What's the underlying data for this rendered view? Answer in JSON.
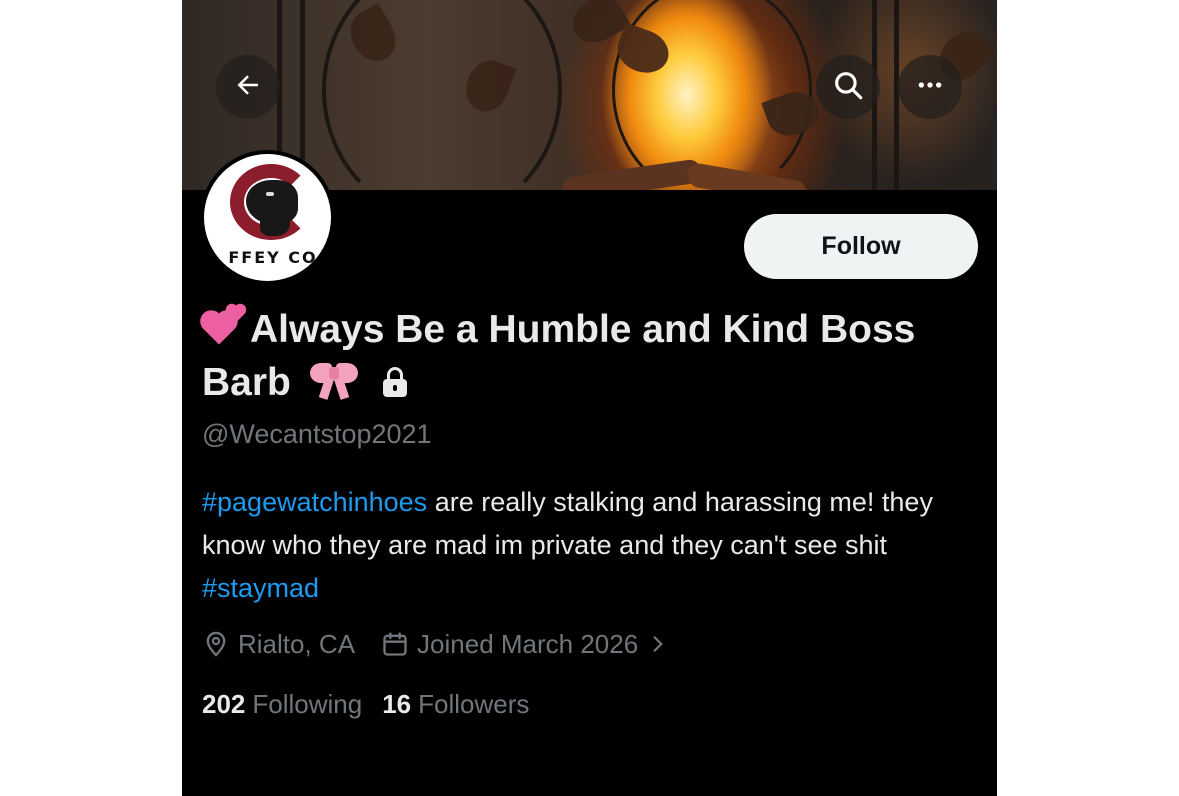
{
  "header": {
    "back_icon": "arrow-left-icon",
    "search_icon": "search-icon",
    "more_icon": "more-horizontal-icon"
  },
  "avatar": {
    "watermark_text": "FFEY CO"
  },
  "actions": {
    "follow_label": "Follow"
  },
  "profile": {
    "name_emoji": "💕",
    "display_name": "Always Be a Humble and Kind Boss Barb",
    "name_suffix_emoji": "🎀",
    "protected_icon": "lock-icon",
    "handle": "@Wecantstop2021",
    "bio": {
      "hashtag_1": "#pagewatchinhoes",
      "text_1": " are really stalking and harassing me! they know who they are mad im private and they can't see shit ",
      "hashtag_2": "#staymad"
    },
    "location": "Rialto, CA",
    "joined": "Joined March 2026"
  },
  "stats": {
    "following_count": "202",
    "following_label": "Following",
    "followers_count": "16",
    "followers_label": "Followers"
  },
  "colors": {
    "background": "#000000",
    "text_primary": "#e7e9ea",
    "text_secondary": "#71767b",
    "hashtag": "#1d9bf0",
    "follow_button_bg": "#eff3f4"
  }
}
